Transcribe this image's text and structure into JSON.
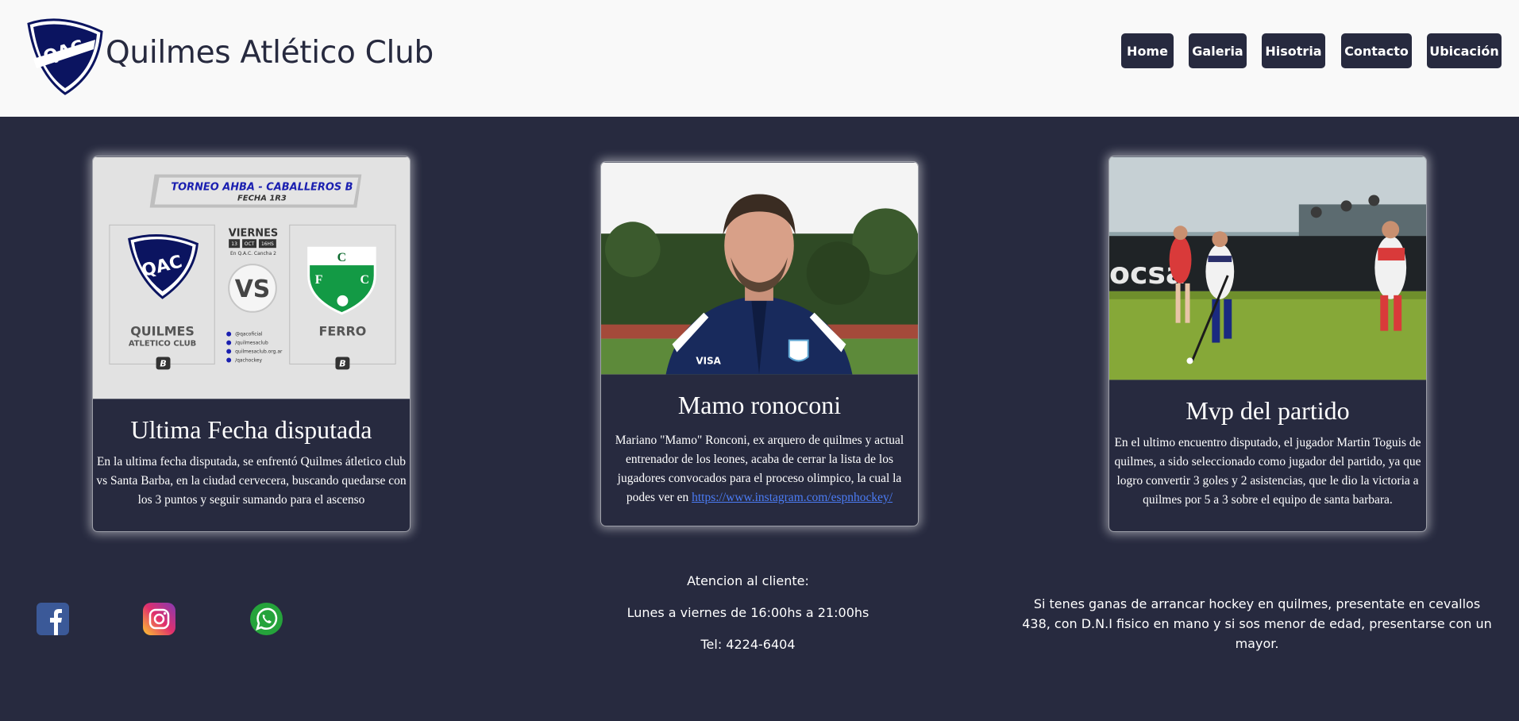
{
  "header": {
    "logo_text": "QAC",
    "title": "Quilmes Atlético Club",
    "nav": [
      "Home",
      "Galeria",
      "Hisotria",
      "Contacto",
      "Ubicación"
    ]
  },
  "cards": [
    {
      "title": "Ultima Fecha disputada",
      "text": "En la ultima fecha disputada, se enfrentó Quilmes átletico club vs Santa Barba, en la ciudad cervecera, buscando quedarse con los 3 puntos y seguir sumando para el ascenso",
      "poster": {
        "tournament": "TORNEO AHBA - CABALLEROS B",
        "round": "FECHA 1R3",
        "day": "VIERNES",
        "date_day": "13",
        "date_month": "OCT",
        "time": "16HS",
        "venue": "En Q.A.C. Cancha 2",
        "vs": "VS",
        "home_name": "QUILMES",
        "home_sub": "ATLETICO CLUB",
        "away_name": "FERRO",
        "division": "B",
        "socials": [
          "@qacoficial",
          "/quilmesaclub",
          "quilmesaclub.org.ar",
          "/qachockey"
        ]
      }
    },
    {
      "title": "Mamo ronoconi",
      "text": "Mariano \"Mamo\" Ronconi, ex arquero de quilmes y actual entrenador de los leones, acaba de cerrar la lista de los jugadores convocados para el proceso olimpico, la cual la podes ver en",
      "link": "https://www.instagram.com/espnhockey/"
    },
    {
      "title": "Mvp del partido",
      "text": "En el ultimo encuentro disputado, el jugador Martin Toguis de quilmes, a sido seleccionado como jugador del partido, ya que logro convertir 3 goles y 2 asistencias, que le dio la victoria a quilmes por 5 a 3 sobre el equipo de santa barbara.",
      "banner_text": "ocsa"
    }
  ],
  "footer": {
    "contact": [
      "Atencion al cliente:",
      "Lunes a viernes de 16:00hs a 21:00hs",
      "Tel: 4224-6404"
    ],
    "info": "Si tenes ganas de arrancar hockey en quilmes, presentate en cevallos 438, con D.N.I fisico en mano y si sos menor de edad, presentarse con un mayor."
  },
  "colors": {
    "background": "#272a3f",
    "header_bg": "#f9f9f9",
    "link": "#4b7cf5",
    "facebook": "#3b5998",
    "whatsapp": "#25a33b"
  },
  "icons": [
    "facebook-icon",
    "instagram-icon",
    "whatsapp-icon"
  ]
}
